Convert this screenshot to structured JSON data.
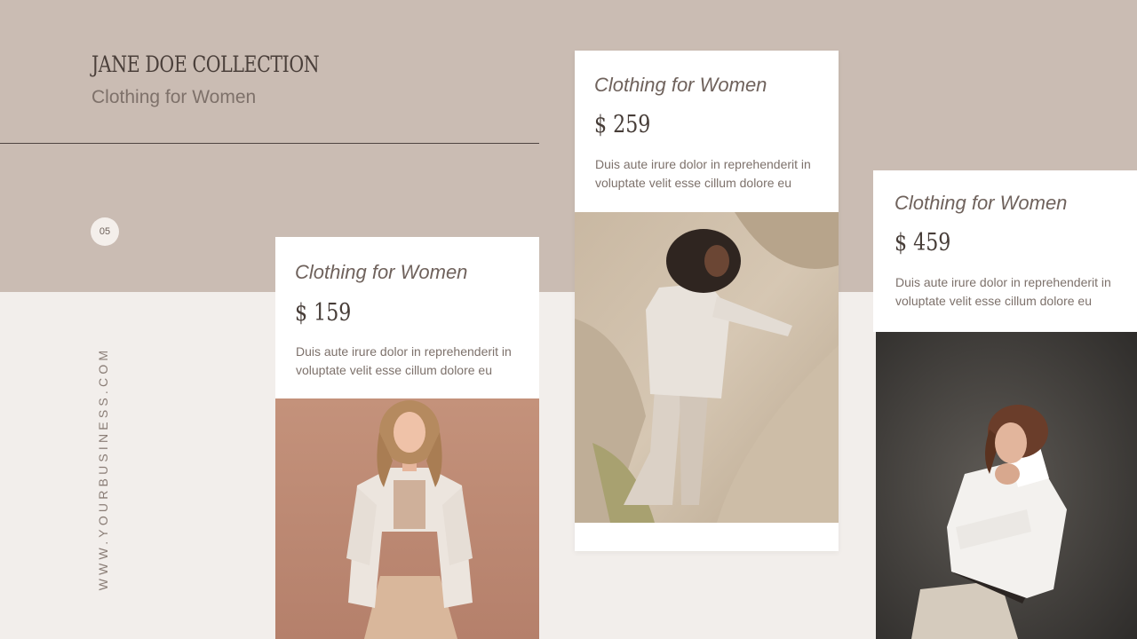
{
  "brand": {
    "title": "JANE DOE COLLECTION",
    "subtitle": "Clothing for Women"
  },
  "page_number": "05",
  "website": "WWW.YOURBUSINESS.COM",
  "products": [
    {
      "title": "Clothing for Women",
      "price": "$ 159",
      "description": "Duis aute irure dolor in reprehenderit in voluptate velit esse cillum dolore eu",
      "photo": "woman-in-blazer-smiling-photo"
    },
    {
      "title": "Clothing for Women",
      "price": "$ 259",
      "description": "Duis aute irure dolor in reprehenderit in voluptate velit esse cillum dolore eu",
      "photo": "woman-climbing-rocks-photo"
    },
    {
      "title": "Clothing for Women",
      "price": "$ 459",
      "description": "Duis aute irure dolor in reprehenderit in voluptate velit esse cillum dolore eu",
      "photo": "woman-in-white-shirt-photo"
    }
  ],
  "colors": {
    "top_band": "#cabcb3",
    "page_background": "#f2eeeb",
    "card_background": "#ffffff",
    "heading_text": "#4a3f3a"
  }
}
